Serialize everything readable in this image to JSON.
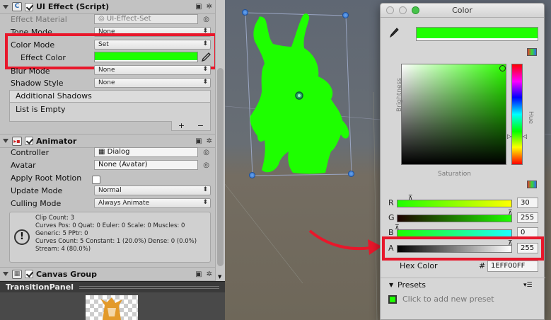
{
  "inspector": {
    "ui_effect": {
      "title": "UI Effect (Script)",
      "rows": {
        "effect_material": {
          "label": "Effect Material",
          "value": "UI-Effect-Set"
        },
        "tone_mode": {
          "label": "Tone Mode",
          "value": "None"
        },
        "color_mode": {
          "label": "Color Mode",
          "value": "Set"
        },
        "effect_color": {
          "label": "Effect Color",
          "color": "#1EFF00"
        },
        "blur_mode": {
          "label": "Blur Mode",
          "value": "None"
        },
        "shadow_style": {
          "label": "Shadow Style",
          "value": "None"
        }
      },
      "additional_shadows": {
        "header": "Additional Shadows",
        "empty_text": "List is Empty",
        "add": "+",
        "remove": "−"
      }
    },
    "animator": {
      "title": "Animator",
      "rows": {
        "controller": {
          "label": "Controller",
          "value": "Dialog"
        },
        "avatar": {
          "label": "Avatar",
          "value": "None (Avatar)"
        },
        "apply_root_motion": {
          "label": "Apply Root Motion"
        },
        "update_mode": {
          "label": "Update Mode",
          "value": "Normal"
        },
        "culling_mode": {
          "label": "Culling Mode",
          "value": "Always Animate"
        }
      },
      "info_lines": [
        "Clip Count: 3",
        "Curves Pos: 0 Quat: 0 Euler: 0 Scale: 0 Muscles: 0",
        "Generic: 5 PPtr: 0",
        "Curves Count: 5 Constant: 1 (20.0%) Dense: 0 (0.0%)",
        "Stream: 4 (80.0%)"
      ]
    },
    "canvas_group": {
      "title": "Canvas Group"
    },
    "preview": {
      "title": "TransitionPanel"
    }
  },
  "color_picker": {
    "title": "Color",
    "current_color": "#1EFF00",
    "brightness_label": "Brightness",
    "saturation_label": "Saturation",
    "hue_label": "Hue",
    "sliders": [
      {
        "label": "R",
        "value": "30",
        "fraction": 0.118
      },
      {
        "label": "G",
        "value": "255",
        "fraction": 1.0
      },
      {
        "label": "B",
        "value": "0",
        "fraction": 0.0
      },
      {
        "label": "A",
        "value": "255",
        "fraction": 1.0
      }
    ],
    "hex_label": "Hex Color",
    "hex_prefix": "#",
    "hex_value": "1EFF00FF",
    "presets_label": "Presets",
    "presets_hint": "Click to add new preset"
  },
  "colors": {
    "highlight": "#e8172b",
    "effect": "#1EFF00",
    "selection_handle": "#3a7fd6"
  }
}
